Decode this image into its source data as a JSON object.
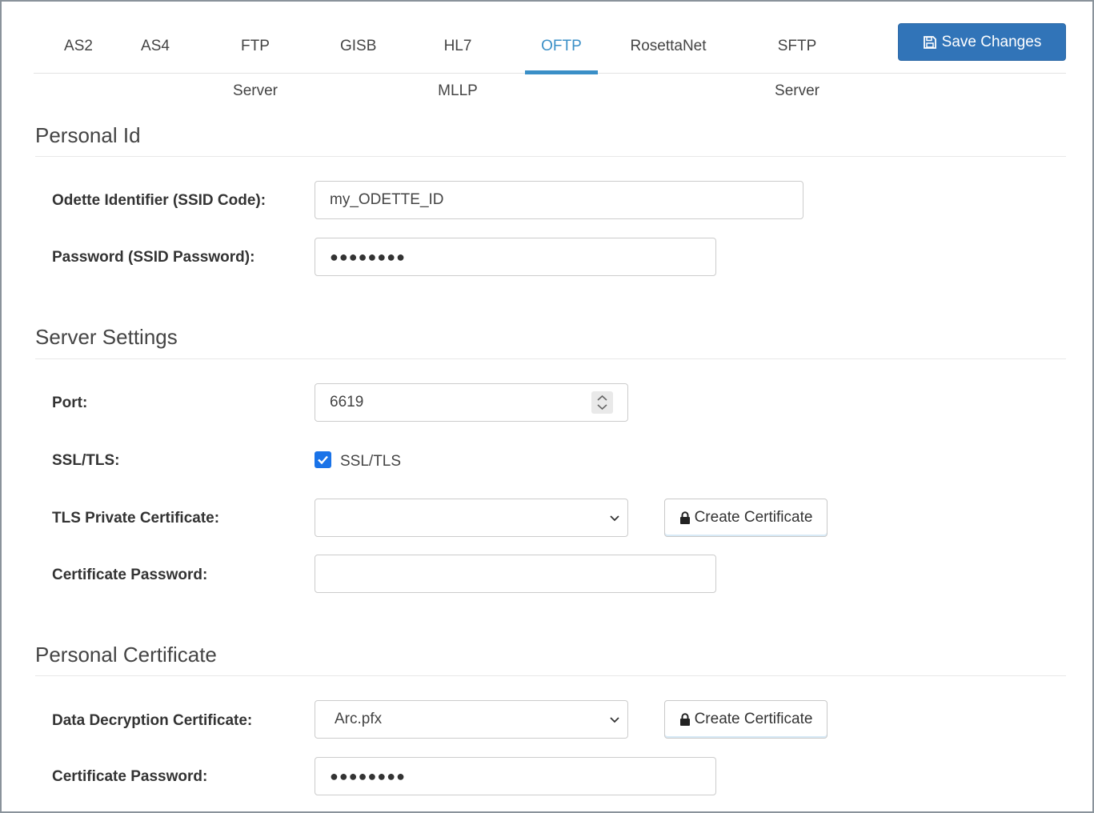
{
  "tabs": [
    {
      "label": "AS2",
      "active": false
    },
    {
      "label": "AS4",
      "active": false
    },
    {
      "label": "FTP Server",
      "active": false
    },
    {
      "label": "GISB",
      "active": false
    },
    {
      "label": "HL7 MLLP",
      "active": false
    },
    {
      "label": "OFTP",
      "active": true
    },
    {
      "label": "RosettaNet",
      "active": false
    },
    {
      "label": "SFTP Server",
      "active": false
    }
  ],
  "toolbar": {
    "save_label": "Save Changes",
    "save_icon": "floppy-disk-icon"
  },
  "colors": {
    "accent": "#3a8fc7",
    "save_button": "#3174b8",
    "checkbox": "#1a73e8"
  },
  "personal_id": {
    "title": "Personal Id",
    "odette_label": "Odette Identifier (SSID Code):",
    "odette_value": "my_ODETTE_ID",
    "password_label": "Password (SSID Password):",
    "password_value": "●●●●●●●●"
  },
  "server_settings": {
    "title": "Server Settings",
    "port_label": "Port:",
    "port_value": "6619",
    "ssl_label": "SSL/TLS:",
    "ssl_checkbox_label": "SSL/TLS",
    "ssl_checked": true,
    "tls_cert_label": "TLS Private Certificate:",
    "tls_cert_value": "",
    "create_cert_label": "Create Certificate",
    "cert_password_label": "Certificate Password:",
    "cert_password_value": ""
  },
  "personal_certificate": {
    "title": "Personal Certificate",
    "decrypt_cert_label": "Data Decryption Certificate:",
    "decrypt_cert_value": "Arc.pfx",
    "create_cert_label": "Create Certificate",
    "cert_password_label": "Certificate Password:",
    "cert_password_value": "●●●●●●●●"
  }
}
